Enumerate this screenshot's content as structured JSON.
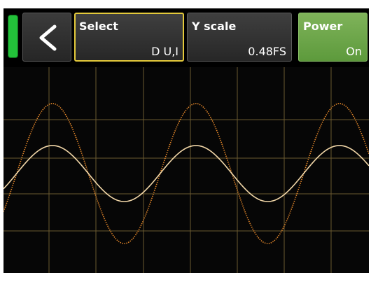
{
  "toolbar": {
    "select": {
      "label": "Select",
      "value": "D U,I"
    },
    "y_scale": {
      "label": "Y scale",
      "value": "0.48FS"
    },
    "power": {
      "label": "Power",
      "value": "On"
    }
  },
  "icons": {
    "back": "chevron-left-icon",
    "power_led": "power-status-indicator"
  },
  "colors": {
    "led_on": "#23c23a",
    "selected_border": "#e3c93b",
    "power_active": "#6ea84a",
    "grid": "#6b5a30",
    "trace_current": "#e8892a",
    "trace_voltage": "#f2d7a8"
  },
  "scope": {
    "cycles_visible": 2.15,
    "current_amplitude": 1.0,
    "voltage_amplitude": 0.4
  }
}
